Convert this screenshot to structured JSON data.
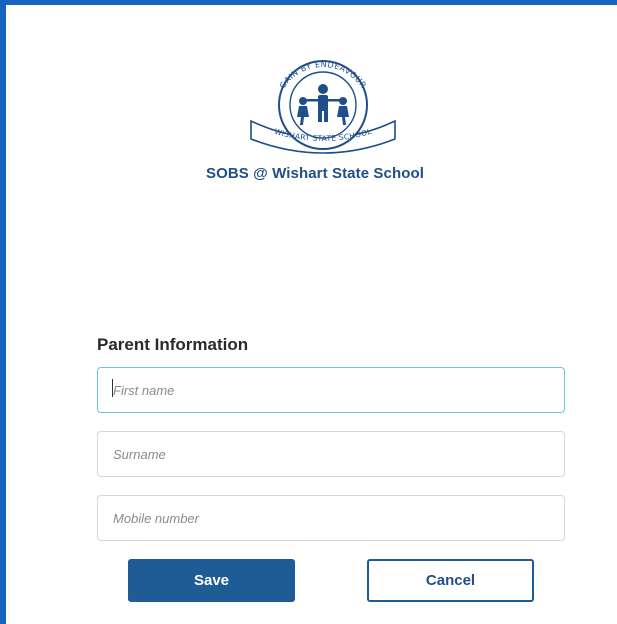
{
  "brand": {
    "school_name": "SOBS @ Wishart State School",
    "logo": {
      "motto": "GAIN BY ENDEAVOUR",
      "banner": "WISHART STATE SCHOOL",
      "colors": {
        "primary": "#1f4e88",
        "accent": "#1565c0"
      }
    }
  },
  "form": {
    "section_title": "Parent Information",
    "fields": {
      "first_name": {
        "placeholder": "First name",
        "value": ""
      },
      "surname": {
        "placeholder": "Surname",
        "value": ""
      },
      "mobile": {
        "placeholder": "Mobile number",
        "value": ""
      }
    },
    "buttons": {
      "save_label": "Save",
      "cancel_label": "Cancel"
    }
  },
  "colors": {
    "frame_border": "#1565c0",
    "primary_button": "#1f5b94",
    "focus_border": "#6cc8d6"
  }
}
